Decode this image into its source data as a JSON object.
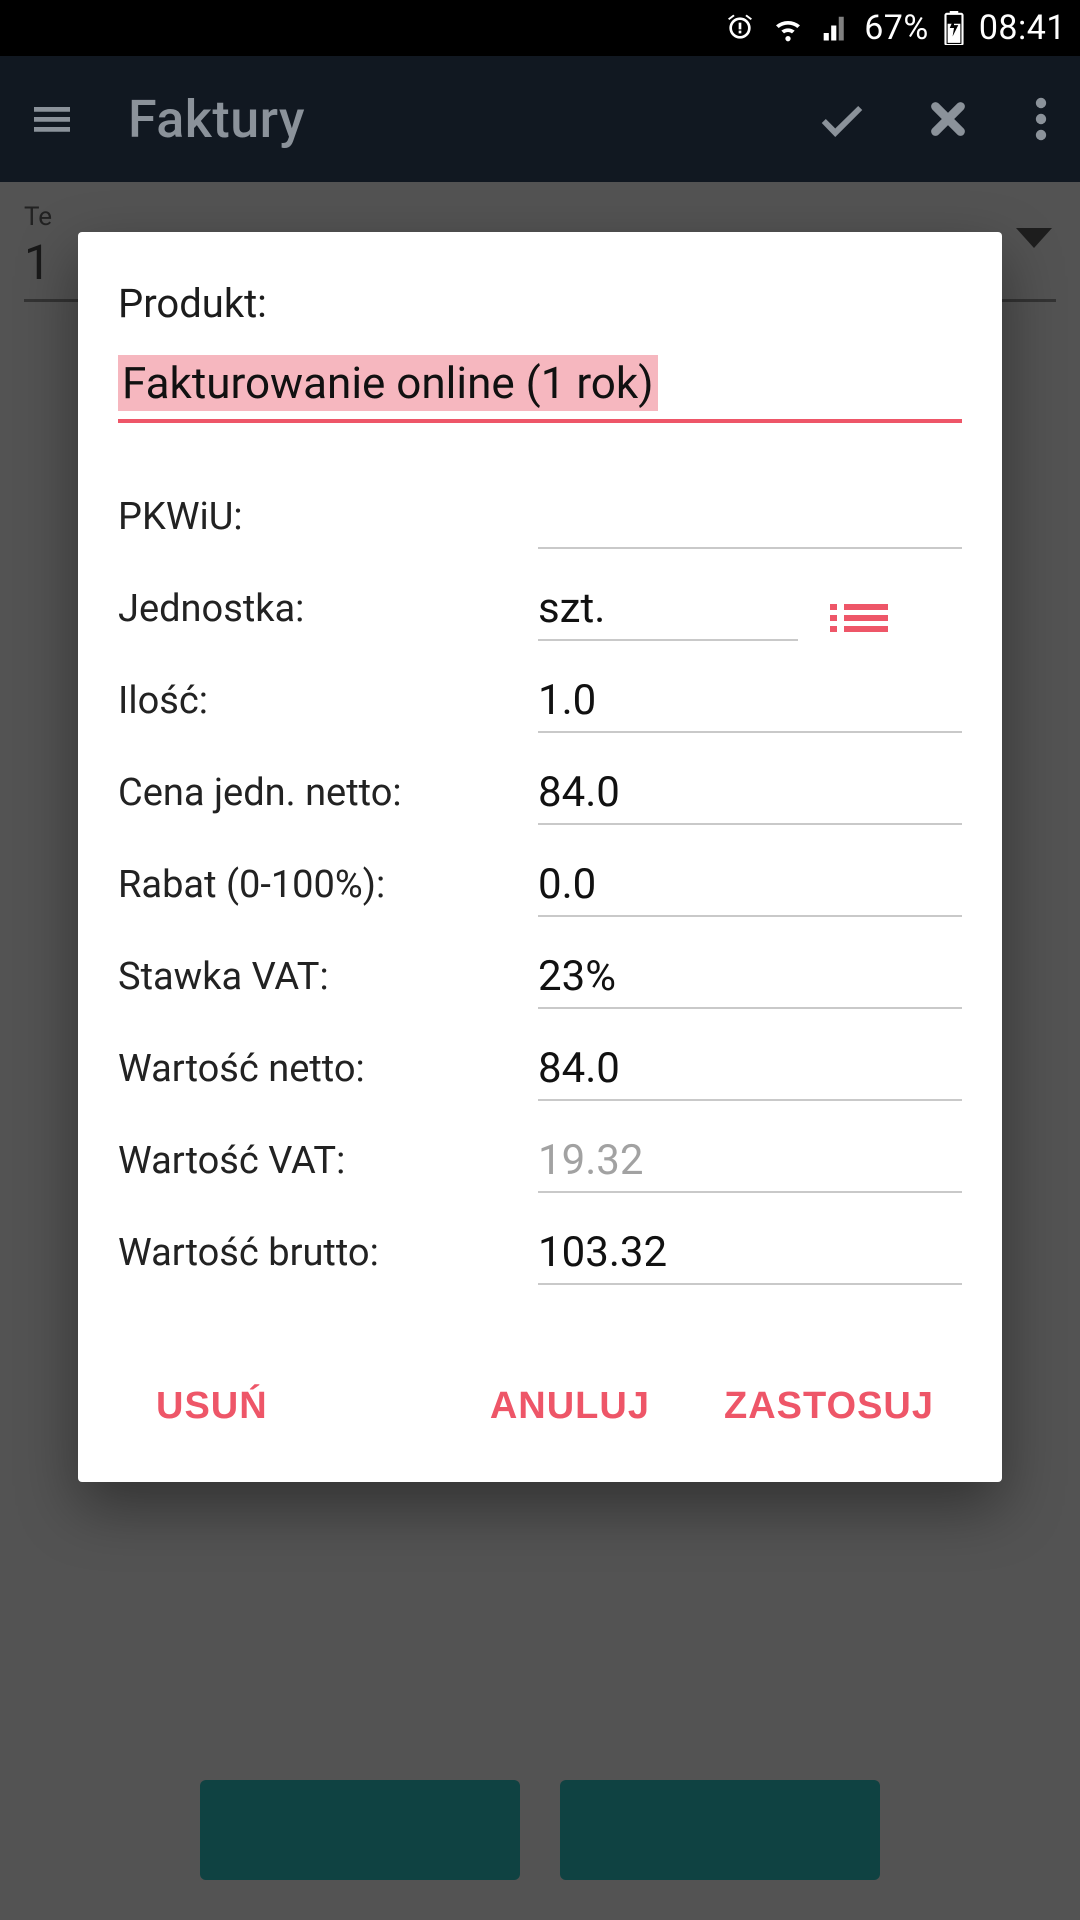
{
  "statusbar": {
    "battery_pct": "67%",
    "time": "08:41"
  },
  "appbar": {
    "title": "Faktury"
  },
  "background": {
    "term_label": "Te",
    "term_value": "1"
  },
  "dialog": {
    "title": "Produkt:",
    "product_name": "Fakturowanie online (1 rok)",
    "rows": {
      "pkwiu_label": "PKWiU:",
      "pkwiu_value": "",
      "unit_label": "Jednostka:",
      "unit_value": "szt.",
      "qty_label": "Ilość:",
      "qty_value": "1.0",
      "unitprice_label": "Cena jedn. netto:",
      "unitprice_value": "84.0",
      "discount_label": "Rabat (0-100%):",
      "discount_value": "0.0",
      "vatrate_label": "Stawka VAT:",
      "vatrate_value": "23%",
      "netval_label": "Wartość netto:",
      "netval_value": "84.0",
      "vatval_label": "Wartość VAT:",
      "vatval_value": "19.32",
      "grossval_label": "Wartość brutto:",
      "grossval_value": "103.32"
    },
    "actions": {
      "delete": "USUŃ",
      "cancel": "ANULUJ",
      "apply": "ZASTOSUJ"
    }
  }
}
